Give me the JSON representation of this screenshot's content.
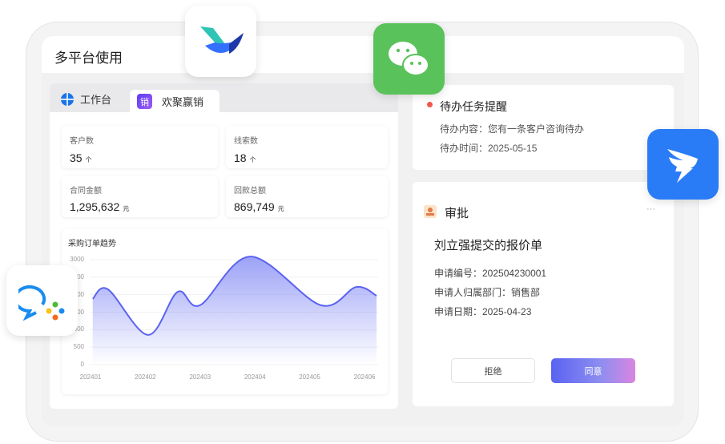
{
  "window": {
    "title": "多平台使用"
  },
  "tabs": [
    {
      "label": "工作台",
      "icon": "workbench-icon"
    },
    {
      "label": "欢聚赢销",
      "icon": "sales-app-icon",
      "badge": "销",
      "active": true
    }
  ],
  "stats": [
    {
      "label": "客户数",
      "value": "35",
      "unit": "个"
    },
    {
      "label": "线索数",
      "value": "18",
      "unit": "个"
    },
    {
      "label": "合同金额",
      "value": "1,295,632",
      "unit": "元"
    },
    {
      "label": "回款总额",
      "value": "869,749",
      "unit": "元"
    }
  ],
  "chart_data": {
    "type": "area",
    "title": "采购订单趋势",
    "xlabel": "",
    "ylabel": "",
    "categories": [
      "202401",
      "202402",
      "202403",
      "202404",
      "202405",
      "202406"
    ],
    "yticks": [
      "0",
      "500",
      "1000",
      "1500",
      "2000",
      "2500",
      "3000"
    ],
    "ylim": [
      0,
      3000
    ],
    "grid": true,
    "series": [
      {
        "name": "采购订单",
        "color": "#5b63f0",
        "points": [
          [
            0.04,
            1880
          ],
          [
            0.32,
            2150
          ],
          [
            1.05,
            850
          ],
          [
            1.59,
            2080
          ],
          [
            2.0,
            1700
          ],
          [
            2.92,
            3090
          ],
          [
            4.2,
            1700
          ],
          [
            4.85,
            2220
          ],
          [
            5.22,
            1970
          ]
        ]
      }
    ]
  },
  "todo": {
    "title": "待办任务提醒",
    "content": "待办内容：您有一条客户咨询待办",
    "time": "待办时间：2025-05-15"
  },
  "approval": {
    "header": "审批",
    "more": "···",
    "title": "刘立强提交的报价单",
    "fields": [
      "申请编号：202504230001",
      "申请人归属部门：销售部",
      "申请日期：2025-04-23"
    ],
    "reject": "拒绝",
    "approve": "同意"
  },
  "colors": {
    "accent": "#5b63f0",
    "wechat": "#5ac25b",
    "dingtalk": "#2a7cf6",
    "todo_dot": "#f5574a"
  }
}
